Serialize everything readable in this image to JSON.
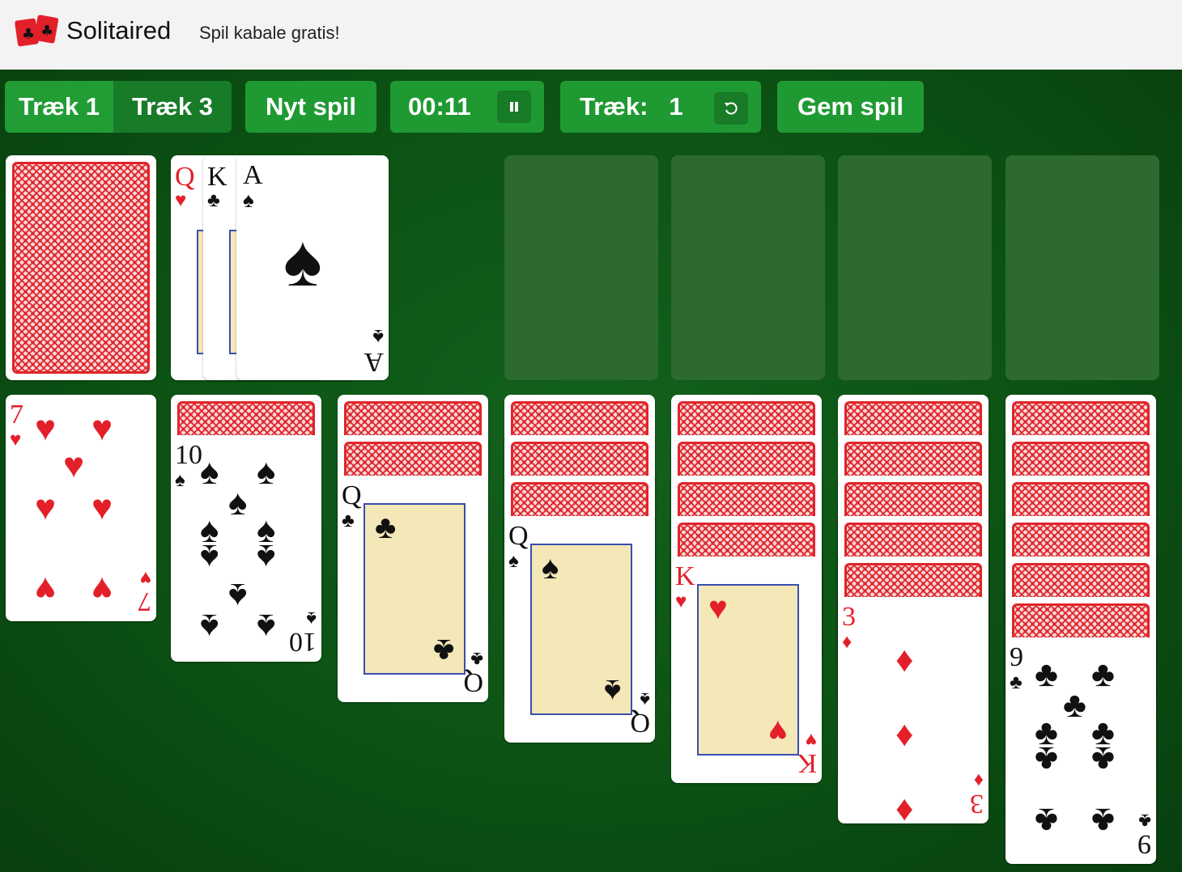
{
  "header": {
    "brand": "Solitaired",
    "tagline": "Spil kabale gratis!"
  },
  "toolbar": {
    "draw1_label": "Træk 1",
    "draw3_label": "Træk 3",
    "new_game_label": "Nyt spil",
    "timer": "00:11",
    "pause_icon": "pause-icon",
    "moves_label": "Træk:",
    "moves_count": "1",
    "undo_icon": "undo-icon",
    "save_label": "Gem spil"
  },
  "colors": {
    "felt": "#0c5214",
    "button": "#1f9a32",
    "card_back": "#e0252b",
    "red_suit": "#e3202a"
  },
  "stock": {
    "face_down": true
  },
  "waste": [
    {
      "rank": "Q",
      "suit": "♥"
    },
    {
      "rank": "K",
      "suit": "♣"
    },
    {
      "rank": "A",
      "suit": "♠"
    }
  ],
  "foundations": [
    {
      "cards": 0
    },
    {
      "cards": 0
    },
    {
      "cards": 0
    },
    {
      "cards": 0
    }
  ],
  "tableau": [
    {
      "hidden": 0,
      "top": {
        "rank": "7",
        "suit": "♥"
      }
    },
    {
      "hidden": 1,
      "top": {
        "rank": "10",
        "suit": "♠"
      }
    },
    {
      "hidden": 2,
      "top": {
        "rank": "Q",
        "suit": "♣"
      }
    },
    {
      "hidden": 3,
      "top": {
        "rank": "Q",
        "suit": "♠"
      }
    },
    {
      "hidden": 4,
      "top": {
        "rank": "K",
        "suit": "♥"
      }
    },
    {
      "hidden": 5,
      "top": {
        "rank": "3",
        "suit": "♦"
      }
    },
    {
      "hidden": 6,
      "top": {
        "rank": "9",
        "suit": "♣"
      }
    }
  ]
}
